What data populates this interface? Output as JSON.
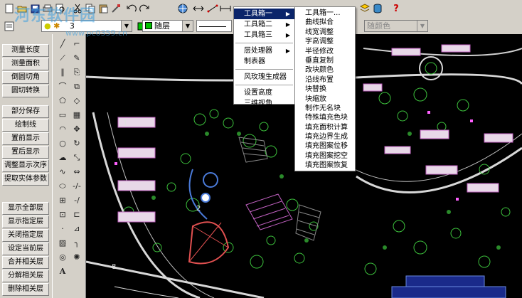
{
  "toolbar": {
    "icons": [
      "new-icon",
      "open-icon",
      "save-icon",
      "print-icon",
      "preview-icon",
      "cut-icon",
      "copy-icon",
      "paste-icon",
      "match-icon",
      "undo-icon",
      "redo-icon",
      "web-icon",
      "pan-icon",
      "zoom-icon"
    ],
    "right_icons": [
      "layer-icon",
      "database-icon",
      "help-icon"
    ],
    "help_label": "?"
  },
  "layer_bar": {
    "layer_value": "3",
    "linetype_value": "随层",
    "color_value": "随颜色"
  },
  "left_panel": {
    "group1": [
      "测量长度",
      "测量面积",
      "倒圆切角",
      "圆切转换"
    ],
    "group2": [
      "部分保存",
      "绘制线",
      "置前显示",
      "置后显示",
      "调整显示次序",
      "提取实体参数"
    ],
    "group3": [
      "显示全部层",
      "显示指定层",
      "关闭指定层",
      "设定当前层",
      "合并相关层",
      "分解相关层",
      "删除相关层"
    ]
  },
  "main_menu": {
    "items": [
      {
        "label": "工具箱一",
        "submenu": true
      },
      {
        "label": "工具箱二",
        "submenu": true
      },
      {
        "label": "工具箱三",
        "submenu": true
      },
      {
        "label": "层处理器",
        "submenu": true
      },
      {
        "label": "制表器",
        "submenu": false
      },
      {
        "label": "风玫瑰生成器",
        "submenu": false
      },
      {
        "label": "设置高度",
        "submenu": false
      },
      {
        "label": "三维视角",
        "submenu": false
      }
    ]
  },
  "sub_menu": {
    "items": [
      "工具箱一...",
      "曲线拟合",
      "线宽调整",
      "字高调整",
      "半径修改",
      "垂直复制",
      "改块颜色",
      "沿线布置",
      "块替换",
      "块缩放",
      "制作无名块",
      "特殊填充色块",
      "填充面积计算",
      "填充边界生成",
      "填充图案位移",
      "填充图案挖空",
      "填充图案恢复"
    ]
  },
  "watermark": {
    "text": "河东软件园",
    "url": "www.pc0359.cn"
  },
  "colors": {
    "menu_highlight": "#0a246a",
    "canvas": "#000000",
    "panel": "#d4d0c8"
  }
}
